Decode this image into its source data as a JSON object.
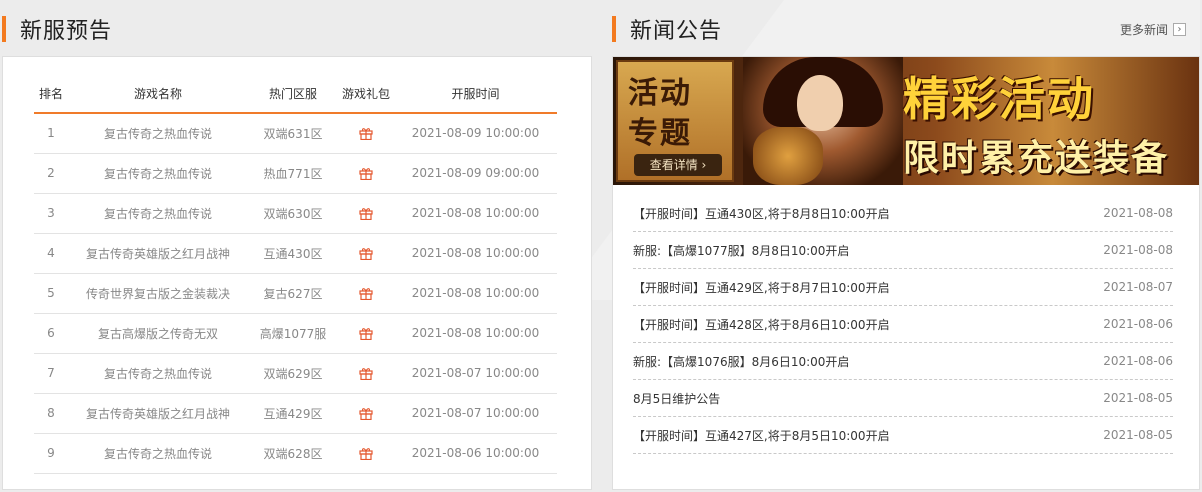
{
  "left_section": {
    "title": "新服预告",
    "columns": [
      "排名",
      "游戏名称",
      "热门区服",
      "游戏礼包",
      "开服时间"
    ],
    "rows": [
      {
        "rank": "1",
        "game": "复古传奇之热血传说",
        "server": "双端631区",
        "time": "2021-08-09 10:00:00"
      },
      {
        "rank": "2",
        "game": "复古传奇之热血传说",
        "server": "热血771区",
        "time": "2021-08-09 09:00:00"
      },
      {
        "rank": "3",
        "game": "复古传奇之热血传说",
        "server": "双端630区",
        "time": "2021-08-08 10:00:00"
      },
      {
        "rank": "4",
        "game": "复古传奇英雄版之红月战神",
        "server": "互通430区",
        "time": "2021-08-08 10:00:00"
      },
      {
        "rank": "5",
        "game": "传奇世界复古版之金装裁决",
        "server": "复古627区",
        "time": "2021-08-08 10:00:00"
      },
      {
        "rank": "6",
        "game": "复古高爆版之传奇无双",
        "server": "高爆1077服",
        "time": "2021-08-08 10:00:00"
      },
      {
        "rank": "7",
        "game": "复古传奇之热血传说",
        "server": "双端629区",
        "time": "2021-08-07 10:00:00"
      },
      {
        "rank": "8",
        "game": "复古传奇英雄版之红月战神",
        "server": "互通429区",
        "time": "2021-08-07 10:00:00"
      },
      {
        "rank": "9",
        "game": "复古传奇之热血传说",
        "server": "双端628区",
        "time": "2021-08-06 10:00:00"
      }
    ],
    "gift_icon": "gift-icon",
    "accent_color": "#f37a1f"
  },
  "right_section": {
    "title": "新闻公告",
    "more_label": "更多新闻",
    "banner": {
      "left_line1": "活动",
      "left_line2": "专题",
      "button_label": "查看详情 ›",
      "headline": "精彩活动",
      "subline": "限时累充送装备"
    },
    "news": [
      {
        "title": "【开服时间】互通430区,将于8月8日10:00开启",
        "date": "2021-08-08"
      },
      {
        "title": "新服:【高爆1077服】8月8日10:00开启",
        "date": "2021-08-08"
      },
      {
        "title": "【开服时间】互通429区,将于8月7日10:00开启",
        "date": "2021-08-07"
      },
      {
        "title": "【开服时间】互通428区,将于8月6日10:00开启",
        "date": "2021-08-06"
      },
      {
        "title": "新服:【高爆1076服】8月6日10:00开启",
        "date": "2021-08-06"
      },
      {
        "title": "8月5日维护公告",
        "date": "2021-08-05"
      },
      {
        "title": "【开服时间】互通427区,将于8月5日10:00开启",
        "date": "2021-08-05"
      }
    ]
  }
}
